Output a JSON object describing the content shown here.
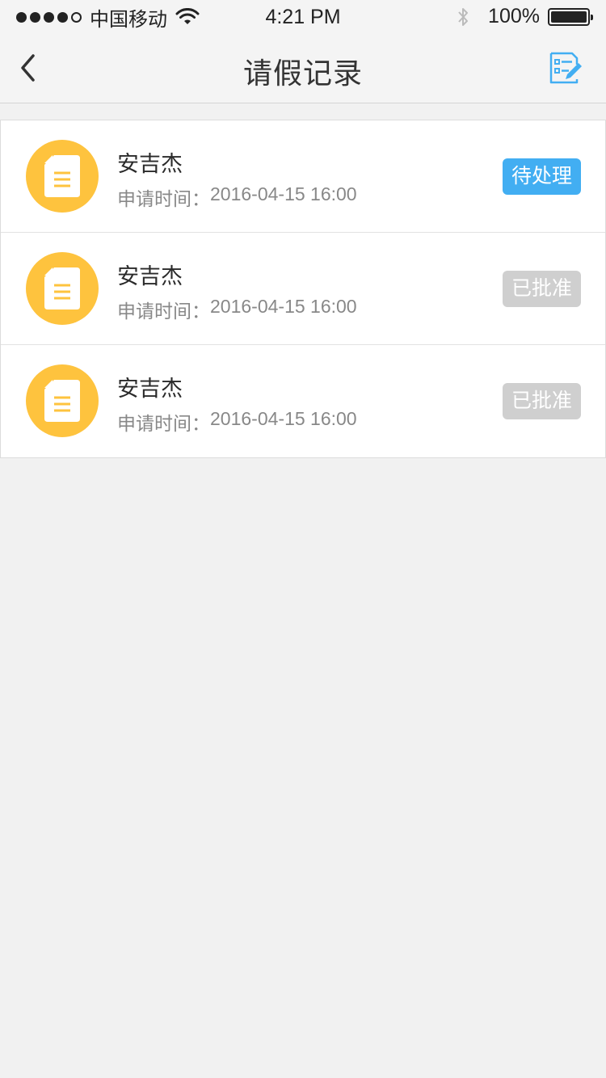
{
  "status_bar": {
    "carrier": "中国移动",
    "time": "4:21 PM",
    "battery": "100%",
    "signal_strength": 4,
    "battery_level": 1.0
  },
  "nav": {
    "title": "请假记录",
    "back_icon": "chevron-left-icon",
    "edit_icon": "edit-document-icon"
  },
  "colors": {
    "accent": "#42aef2",
    "avatar": "#fec33e",
    "approved_badge": "#cfcfcf",
    "background": "#f1f1f1"
  },
  "records": [
    {
      "name": "安吉杰",
      "time_label": "申请时间：",
      "time_value": "2016-04-15 16:00",
      "status": "待处理",
      "status_type": "pending"
    },
    {
      "name": "安吉杰",
      "time_label": "申请时间：",
      "time_value": "2016-04-15 16:00",
      "status": "已批准",
      "status_type": "approved"
    },
    {
      "name": "安吉杰",
      "time_label": "申请时间：",
      "time_value": "2016-04-15 16:00",
      "status": "已批准",
      "status_type": "approved"
    }
  ]
}
